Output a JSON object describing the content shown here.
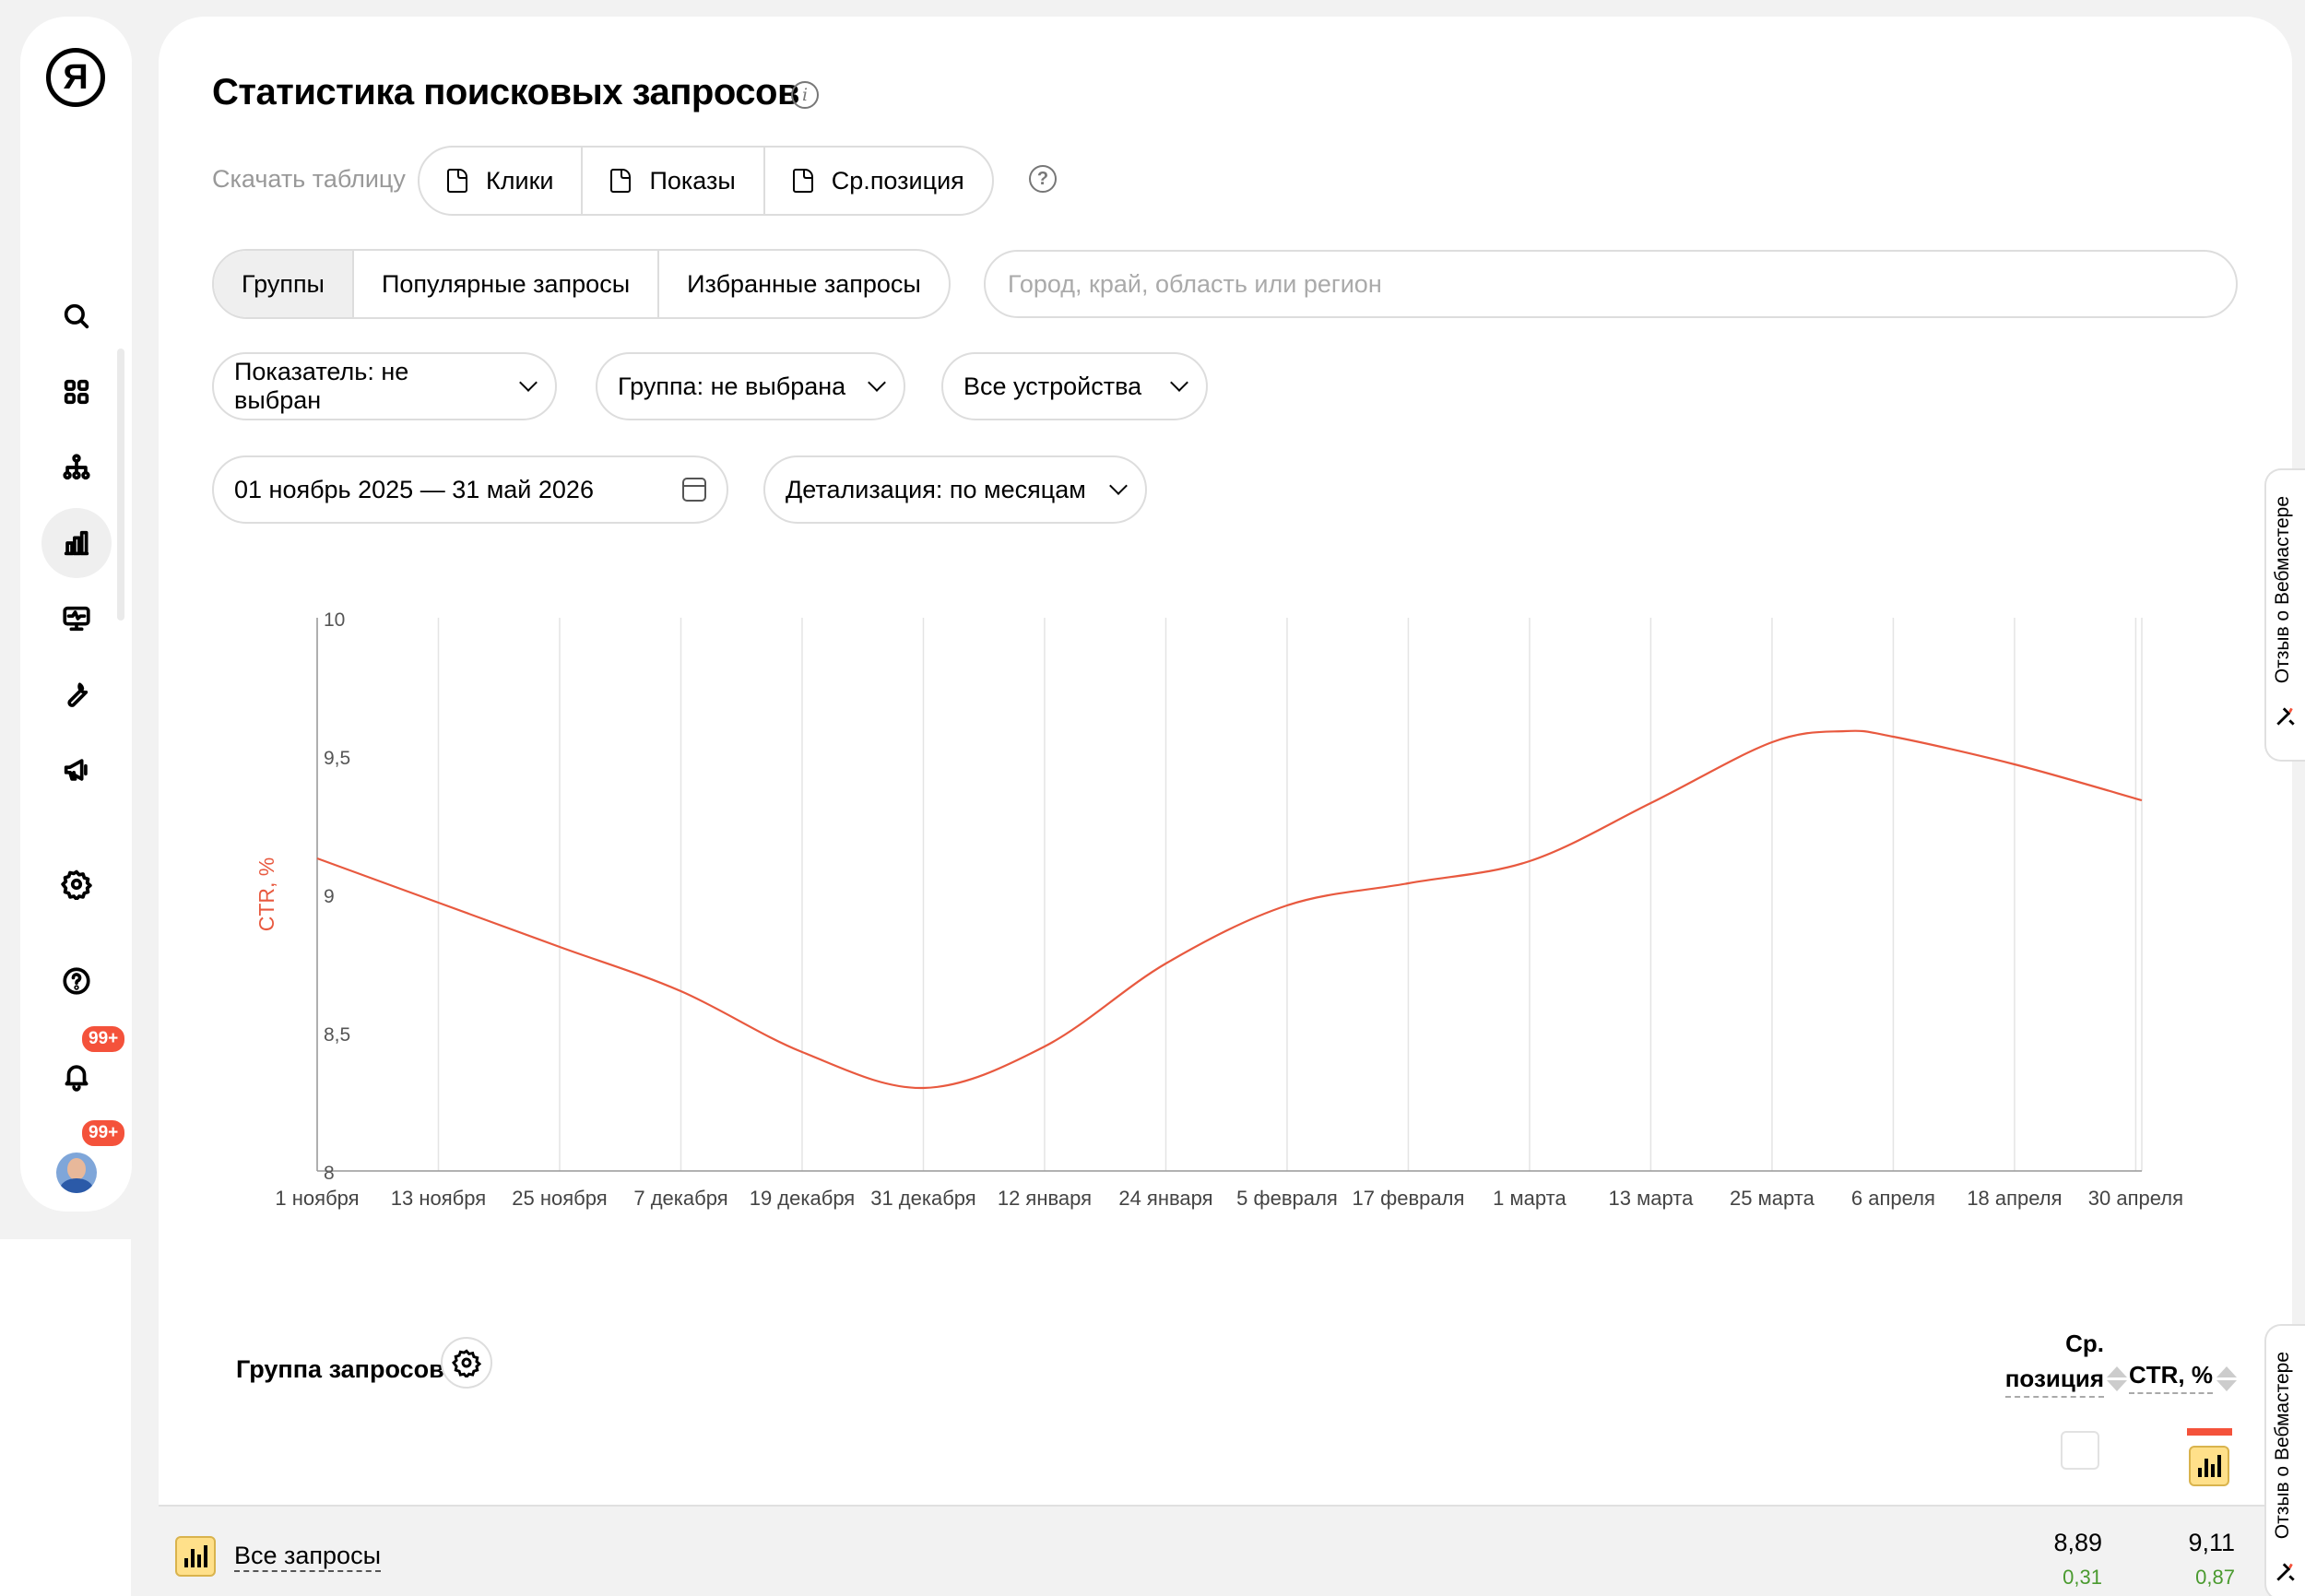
{
  "sidebar": {
    "logo": "Я",
    "icons": [
      "search-icon",
      "dashboard-icon",
      "site-structure-icon",
      "stats-icon",
      "monitoring-icon",
      "tools-icon",
      "megaphone-icon",
      "gear-icon",
      "help-icon",
      "bell-icon"
    ],
    "notifications_badge": "99+",
    "avatar_badge": "99+"
  },
  "header": {
    "title": "Статистика поисковых запросов"
  },
  "download": {
    "label": "Скачать таблицу",
    "buttons": [
      "Клики",
      "Показы",
      "Ср.позиция"
    ]
  },
  "tabs": [
    "Группы",
    "Популярные запросы",
    "Избранные запросы"
  ],
  "region": {
    "placeholder": "Город, край, область или регион"
  },
  "filters": {
    "metric": "Показатель: не выбран",
    "group": "Группа: не выбрана",
    "devices": "Все устройства",
    "date_range": "01 ноябрь 2025 — 31 май 2026",
    "detail": "Детализация: по месяцам"
  },
  "chart_data": {
    "type": "line",
    "ylabel": "CTR, %",
    "ylim": [
      8,
      10
    ],
    "y_ticks": [
      "10",
      "9,5",
      "9",
      "8,5",
      "8"
    ],
    "x_ticks": [
      "1 ноября",
      "13 ноября",
      "25 ноября",
      "7 декабря",
      "19 декабря",
      "31 декабря",
      "12 января",
      "24 января",
      "5 февраля",
      "17 февраля",
      "1 марта",
      "13 марта",
      "25 марта",
      "6 апреля",
      "18 апреля",
      "30 апреля"
    ],
    "series": [
      {
        "color": "#e8593f",
        "points": [
          {
            "tick": 0,
            "value": 9.13
          },
          {
            "tick": 1,
            "value": 8.97
          },
          {
            "tick": 2,
            "value": 8.81
          },
          {
            "tick": 3,
            "value": 8.65
          },
          {
            "tick": 4,
            "value": 8.43
          },
          {
            "tick": 5,
            "value": 8.3
          },
          {
            "tick": 6,
            "value": 8.45
          },
          {
            "tick": 7,
            "value": 8.75
          },
          {
            "tick": 8,
            "value": 8.96
          },
          {
            "tick": 9,
            "value": 9.04
          },
          {
            "tick": 10,
            "value": 9.12
          },
          {
            "tick": 11,
            "value": 9.33
          },
          {
            "tick": 12,
            "value": 9.55
          },
          {
            "tick": 12.6,
            "value": 9.59
          },
          {
            "tick": 13,
            "value": 9.57
          },
          {
            "tick": 14,
            "value": 9.47
          },
          {
            "tick": 15.05,
            "value": 9.34
          }
        ]
      }
    ]
  },
  "table": {
    "group_header": "Группа запросов",
    "col_position_line1": "Ср.",
    "col_position_line2": "позиция",
    "col_ctr": "CTR, %",
    "rows": [
      {
        "label": "Все запросы",
        "position": "8,89",
        "position_delta": "0,31",
        "ctr": "9,11",
        "ctr_delta": "0,87"
      }
    ]
  },
  "feedback": {
    "label": "Отзыв о Вебмастере"
  }
}
